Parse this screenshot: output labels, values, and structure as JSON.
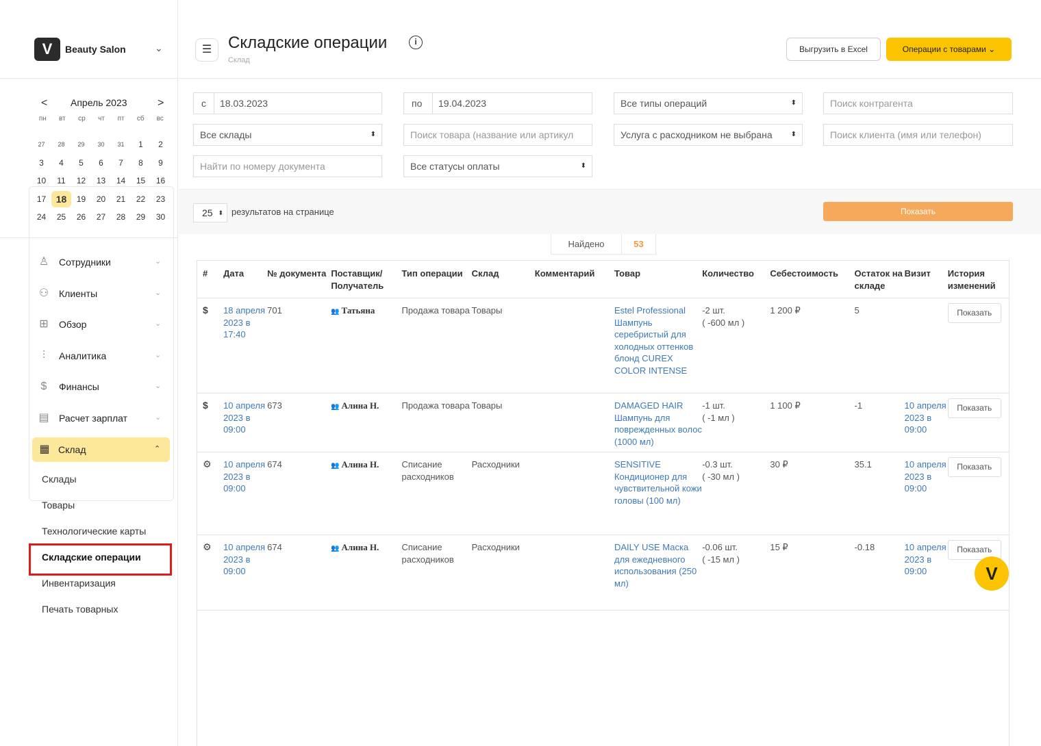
{
  "brand": {
    "name": "Beauty Salon",
    "logo_text": "V"
  },
  "calendar": {
    "month": "Апрель 2023",
    "prev": "<",
    "next": ">",
    "dow": [
      "пн",
      "вт",
      "ср",
      "чт",
      "пт",
      "сб",
      "вс"
    ],
    "weeks": [
      [
        "27",
        "28",
        "29",
        "30",
        "31",
        "1",
        "2"
      ],
      [
        "3",
        "4",
        "5",
        "6",
        "7",
        "8",
        "9"
      ],
      [
        "10",
        "11",
        "12",
        "13",
        "14",
        "15",
        "16"
      ],
      [
        "17",
        "18",
        "19",
        "20",
        "21",
        "22",
        "23"
      ],
      [
        "24",
        "25",
        "26",
        "27",
        "28",
        "29",
        "30"
      ]
    ],
    "today": "18"
  },
  "menu": {
    "items": [
      {
        "label": "Сотрудники",
        "icon": "person-icon"
      },
      {
        "label": "Клиенты",
        "icon": "people-icon"
      },
      {
        "label": "Обзор",
        "icon": "grid-icon"
      },
      {
        "label": "Аналитика",
        "icon": "analytics-icon"
      },
      {
        "label": "Финансы",
        "icon": "dollar-circle-icon"
      },
      {
        "label": "Расчет зарплат",
        "icon": "payroll-icon"
      }
    ],
    "active": {
      "label": "Склад",
      "icon": "warehouse-icon"
    },
    "submenu": [
      "Склады",
      "Товары",
      "Технологические карты",
      "Складские операции",
      "Инвентаризация",
      "Печать товарных"
    ]
  },
  "header": {
    "title": "Складские операции",
    "breadcrumb": "Склад",
    "export_label": "Выгрузить в Excel",
    "ops_label": "Операции с товарами"
  },
  "filters": {
    "from_prefix": "с",
    "from_date": "18.03.2023",
    "to_prefix": "по",
    "to_date": "19.04.2023",
    "op_types": "Все типы операций",
    "contractor_placeholder": "Поиск контрагента",
    "warehouses": "Все склады",
    "product_placeholder": "Поиск товара (название или артикул",
    "service": "Услуга с расходником не выбрана",
    "client_placeholder": "Поиск клиента (имя или телефон)",
    "doc_placeholder": "Найти по номеру документа",
    "payment_status": "Все статусы оплаты",
    "per_page": "25",
    "per_page_label": "результатов на странице",
    "show_label": "Показать"
  },
  "found": {
    "label": "Найдено",
    "count": "53"
  },
  "table": {
    "headers": [
      "#",
      "Дата",
      "№ документа",
      "Поставщик/ Получатель",
      "Тип операции",
      "Склад",
      "Комментарий",
      "Товар",
      "Количество",
      "Себестоимость",
      "Остаток на складе",
      "Визит",
      "История изменений"
    ],
    "rows": [
      {
        "icon": "$",
        "date": "18 апреля 2023 в 17:40",
        "doc": "701",
        "contractor": "Татьяна",
        "type": "Продажа товара",
        "warehouse": "Товары",
        "comment": "",
        "product": "Estel Professional Шампунь серебристый для холодных оттенков блонд CUREX COLOR INTENSE",
        "qty": "-2 шт.",
        "qty_ml": "( -600 мл )",
        "cost": "1 200 ₽",
        "rest": "5",
        "visit": "",
        "history": "Показать"
      },
      {
        "icon": "$",
        "date": "10 апреля 2023 в 09:00",
        "doc": "673",
        "contractor": "Алина Н.",
        "type": "Продажа товара",
        "warehouse": "Товары",
        "comment": "",
        "product": "DAMAGED HAIR Шампунь для поврежденных волос (1000 мл)",
        "qty": "-1 шт.",
        "qty_ml": "( -1 мл )",
        "cost": "1 100 ₽",
        "rest": "-1",
        "visit": "10 апреля 2023 в 09:00",
        "history": "Показать"
      },
      {
        "icon": "⚙",
        "date": "10 апреля 2023 в 09:00",
        "doc": "674",
        "contractor": "Алина Н.",
        "type": "Списание расходников",
        "warehouse": "Расходники",
        "comment": "",
        "product": "SENSITIVE Кондиционер для чувствительной кожи головы (100 мл)",
        "qty": "-0.3 шт.",
        "qty_ml": "( -30 мл )",
        "cost": "30 ₽",
        "rest": "35.1",
        "visit": "10 апреля 2023 в 09:00",
        "history": "Показать"
      },
      {
        "icon": "⚙",
        "date": "10 апреля 2023 в 09:00",
        "doc": "674",
        "contractor": "Алина Н.",
        "type": "Списание расходников",
        "warehouse": "Расходники",
        "comment": "",
        "product": "DAILY USE Маска для ежедневного использования (250 мл)",
        "qty": "-0.06 шт.",
        "qty_ml": "( -15 мл )",
        "cost": "15 ₽",
        "rest": "-0.18",
        "visit": "10 апреля 2023 в 09:00",
        "history": "Показать"
      }
    ]
  },
  "colors": {
    "accent": "#fcc400",
    "show_button": "#f6a85b",
    "link": "#3d7ab8",
    "found_count": "#f59a3c",
    "highlight": "#e01919"
  }
}
